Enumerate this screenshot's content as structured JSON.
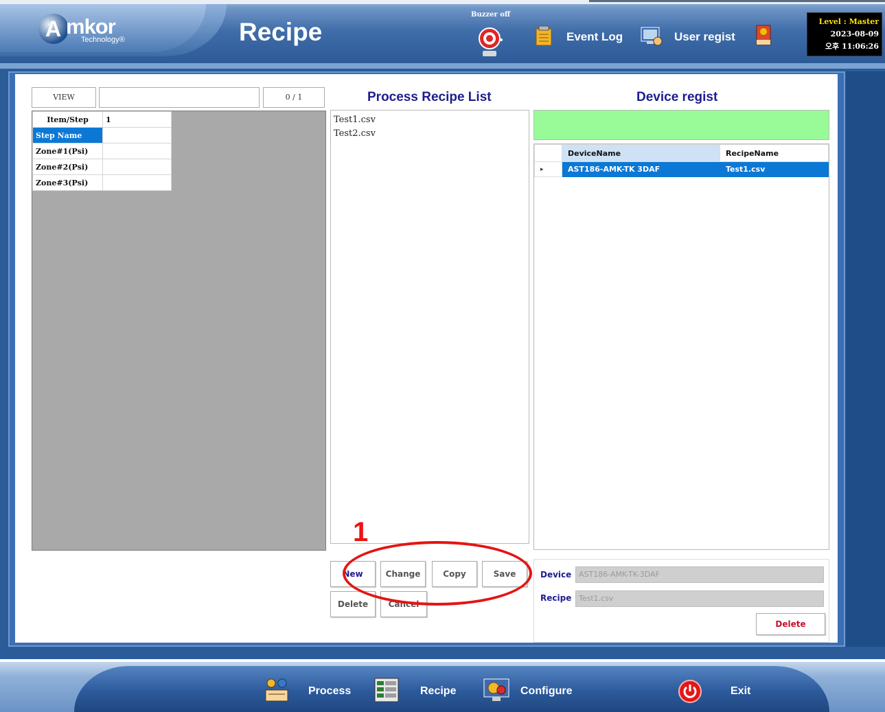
{
  "header": {
    "logo_text": "mkor",
    "logo_initial": "A",
    "logo_sub": "Technology®",
    "title": "Recipe",
    "buzzer_label": "Buzzer off",
    "event_log": "Event Log",
    "user_regist": "User regist",
    "status": {
      "level": "Level : Master",
      "date": "2023-08-09",
      "time": "오후 11:06:26"
    }
  },
  "left_panel": {
    "view_label": "VIEW",
    "view_value": "",
    "page_count": "0 / 1",
    "grid": {
      "header": [
        "Item/Step",
        "1"
      ],
      "rows": [
        "Step Name",
        "Zone#1(Psi)",
        "Zone#2(Psi)",
        "Zone#3(Psi)"
      ],
      "selected_row": "Step Name"
    }
  },
  "recipe_list": {
    "title": "Process Recipe List",
    "items": [
      "Test1.csv",
      "Test2.csv"
    ],
    "buttons": {
      "new": "New",
      "change": "Change",
      "copy": "Copy",
      "save": "Save",
      "delete": "Delete",
      "cancel": "Cancel"
    }
  },
  "annotation": {
    "number": "1",
    "color": "#e41414"
  },
  "device_regist": {
    "title": "Device regist",
    "banner_color": "#98fb98",
    "columns": [
      "DeviceName",
      "RecipeName"
    ],
    "rows": [
      {
        "indicator": "▸",
        "device": "AST186-AMK-TK 3DAF",
        "recipe": "Test1.csv"
      }
    ],
    "device_label": "Device",
    "device_value": "AST186-AMK-TK-3DAF",
    "recipe_label": "Recipe",
    "recipe_value": "Test1.csv",
    "delete_label": "Delete"
  },
  "footer": {
    "process": "Process",
    "recipe": "Recipe",
    "configure": "Configure",
    "exit": "Exit"
  },
  "colors": {
    "accent_blue": "#0b78d6",
    "title_navy": "#1d1d8f",
    "frame_blue": "#2b5b98"
  }
}
